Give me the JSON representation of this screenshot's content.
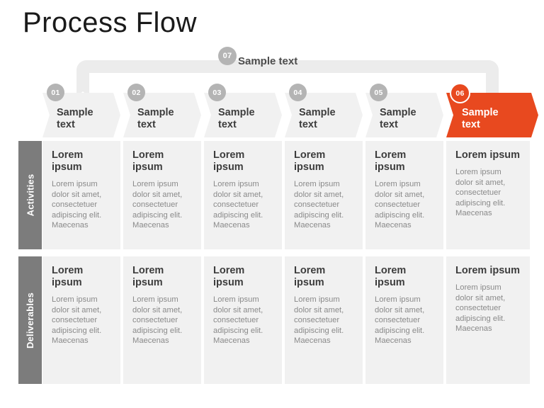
{
  "page": {
    "title": "Process Flow",
    "accent_color": "#e8491f",
    "muted_color": "#b4b4b4",
    "label_bar_color": "#7c7c7c",
    "cell_color": "#f1f1f1"
  },
  "overview": {
    "badge": "07",
    "label": "Sample text"
  },
  "steps": [
    {
      "badge": "01",
      "label": "Sample\ntext",
      "active": false
    },
    {
      "badge": "02",
      "label": "Sample\ntext",
      "active": false
    },
    {
      "badge": "03",
      "label": "Sample\ntext",
      "active": false
    },
    {
      "badge": "04",
      "label": "Sample\ntext",
      "active": false
    },
    {
      "badge": "05",
      "label": "Sample\ntext",
      "active": false
    },
    {
      "badge": "06",
      "label": "Sample\ntext",
      "active": true
    }
  ],
  "rows": [
    {
      "label": "Activities",
      "cells": [
        {
          "heading": "Lorem ipsum",
          "body": "Lorem ipsum dolor sit amet, consectetuer adipiscing elit. Maecenas"
        },
        {
          "heading": "Lorem ipsum",
          "body": "Lorem ipsum dolor sit amet, consectetuer adipiscing elit. Maecenas"
        },
        {
          "heading": "Lorem ipsum",
          "body": "Lorem ipsum dolor sit amet, consectetuer adipiscing elit. Maecenas"
        },
        {
          "heading": "Lorem ipsum",
          "body": "Lorem ipsum dolor sit amet, consectetuer adipiscing elit. Maecenas"
        },
        {
          "heading": "Lorem ipsum",
          "body": "Lorem ipsum dolor sit amet, consectetuer adipiscing elit. Maecenas"
        },
        {
          "heading": "Lorem ipsum",
          "body": "Lorem ipsum dolor sit amet, consectetuer adipiscing elit. Maecenas"
        }
      ]
    },
    {
      "label": "Deliverables",
      "cells": [
        {
          "heading": "Lorem ipsum",
          "body": "Lorem ipsum dolor sit amet, consectetuer adipiscing elit. Maecenas"
        },
        {
          "heading": "Lorem ipsum",
          "body": "Lorem ipsum dolor sit amet, consectetuer adipiscing elit. Maecenas"
        },
        {
          "heading": "Lorem ipsum",
          "body": "Lorem ipsum dolor sit amet, consectetuer adipiscing elit. Maecenas"
        },
        {
          "heading": "Lorem ipsum",
          "body": "Lorem ipsum dolor sit amet, consectetuer adipiscing elit. Maecenas"
        },
        {
          "heading": "Lorem ipsum",
          "body": "Lorem ipsum dolor sit amet, consectetuer adipiscing elit. Maecenas"
        },
        {
          "heading": "Lorem ipsum",
          "body": "Lorem ipsum dolor sit amet, consectetuer adipiscing elit. Maecenas"
        }
      ]
    }
  ]
}
